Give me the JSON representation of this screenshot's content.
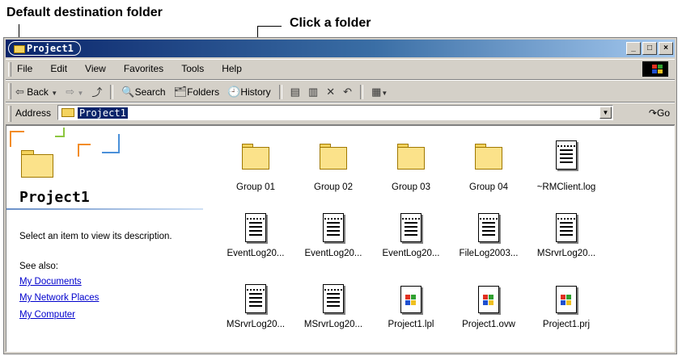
{
  "annotations": {
    "default_folder": "Default destination folder",
    "click_folder": "Click a folder"
  },
  "window": {
    "title": "Project1",
    "caption_buttons": [
      "_",
      "□",
      "×"
    ]
  },
  "menu": [
    "File",
    "Edit",
    "View",
    "Favorites",
    "Tools",
    "Help"
  ],
  "toolbar": {
    "back": "Back",
    "search": "Search",
    "folders": "Folders",
    "history": "History"
  },
  "address": {
    "label": "Address",
    "value": "Project1",
    "go": "Go"
  },
  "webview": {
    "title": "Project1",
    "description": "Select an item to view its description.",
    "see_also": "See also:",
    "links": [
      "My Documents",
      "My Network Places",
      "My Computer"
    ]
  },
  "items": [
    {
      "label": "Group 01",
      "type": "folder"
    },
    {
      "label": "Group 02",
      "type": "folder"
    },
    {
      "label": "Group 03",
      "type": "folder"
    },
    {
      "label": "Group 04",
      "type": "folder"
    },
    {
      "label": "~RMClient.log",
      "type": "log"
    },
    {
      "label": "EventLog20...",
      "type": "log"
    },
    {
      "label": "EventLog20...",
      "type": "log"
    },
    {
      "label": "EventLog20...",
      "type": "log"
    },
    {
      "label": "FileLog2003...",
      "type": "log"
    },
    {
      "label": "MSrvrLog20...",
      "type": "log"
    },
    {
      "label": "MSrvrLog20...",
      "type": "log"
    },
    {
      "label": "MSrvrLog20...",
      "type": "log"
    },
    {
      "label": "Project1.lpl",
      "type": "app"
    },
    {
      "label": "Project1.ovw",
      "type": "app"
    },
    {
      "label": "Project1.prj",
      "type": "app"
    }
  ],
  "colors": {
    "titlebar": "#0a246a",
    "folder": "#fbe28a",
    "link": "#0000cc",
    "selection": "#0a246a"
  }
}
